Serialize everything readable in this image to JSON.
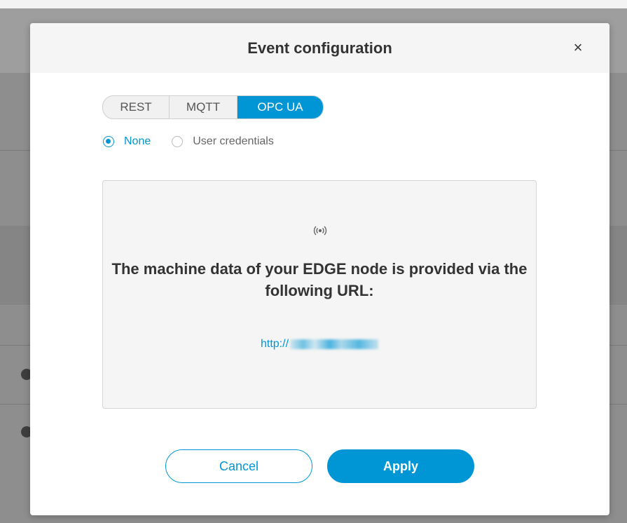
{
  "dialog": {
    "title": "Event configuration",
    "close_symbol": "×"
  },
  "protocol_tabs": [
    {
      "label": "REST",
      "selected": false
    },
    {
      "label": "MQTT",
      "selected": false
    },
    {
      "label": "OPC UA",
      "selected": true
    }
  ],
  "auth": {
    "options": [
      {
        "label": "None",
        "checked": true
      },
      {
        "label": "User credentials",
        "checked": false
      }
    ]
  },
  "panel": {
    "icon": "signal-broadcast-icon",
    "message": "The machine data of your EDGE node is provided via the following URL:",
    "url_prefix": "http://"
  },
  "buttons": {
    "cancel": "Cancel",
    "apply": "Apply"
  },
  "colors": {
    "accent": "#0096d6"
  }
}
